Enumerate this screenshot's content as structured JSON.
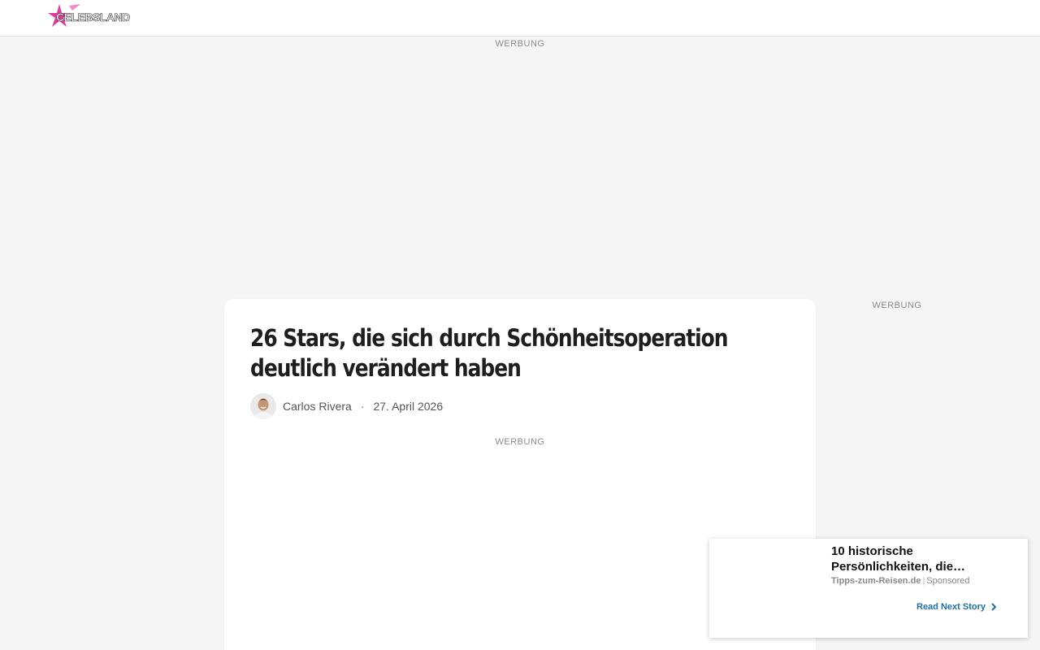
{
  "header": {
    "logo_text": "CELEBSLAND"
  },
  "ads": {
    "top_label": "WERBUNG",
    "side_label": "WERBUNG",
    "inline_label": "WERBUNG"
  },
  "article": {
    "title": "26 Stars, die sich durch Schönheitsoperation deutlich verändert haben",
    "author": "Carlos Rivera",
    "separator": "·",
    "date": "27. April 2026"
  },
  "next_story": {
    "title": "10 historische Persönlichkeiten, die…",
    "source": "Tipps-zum-Reisen.de",
    "divider": "|",
    "sponsored": "Sponsored",
    "cta": "Read Next Story",
    "cta_icon": "chevron-right-icon"
  },
  "colors": {
    "background": "#f5f5f5",
    "logo_star": "#e0399a",
    "cta": "#1f6fa8"
  }
}
